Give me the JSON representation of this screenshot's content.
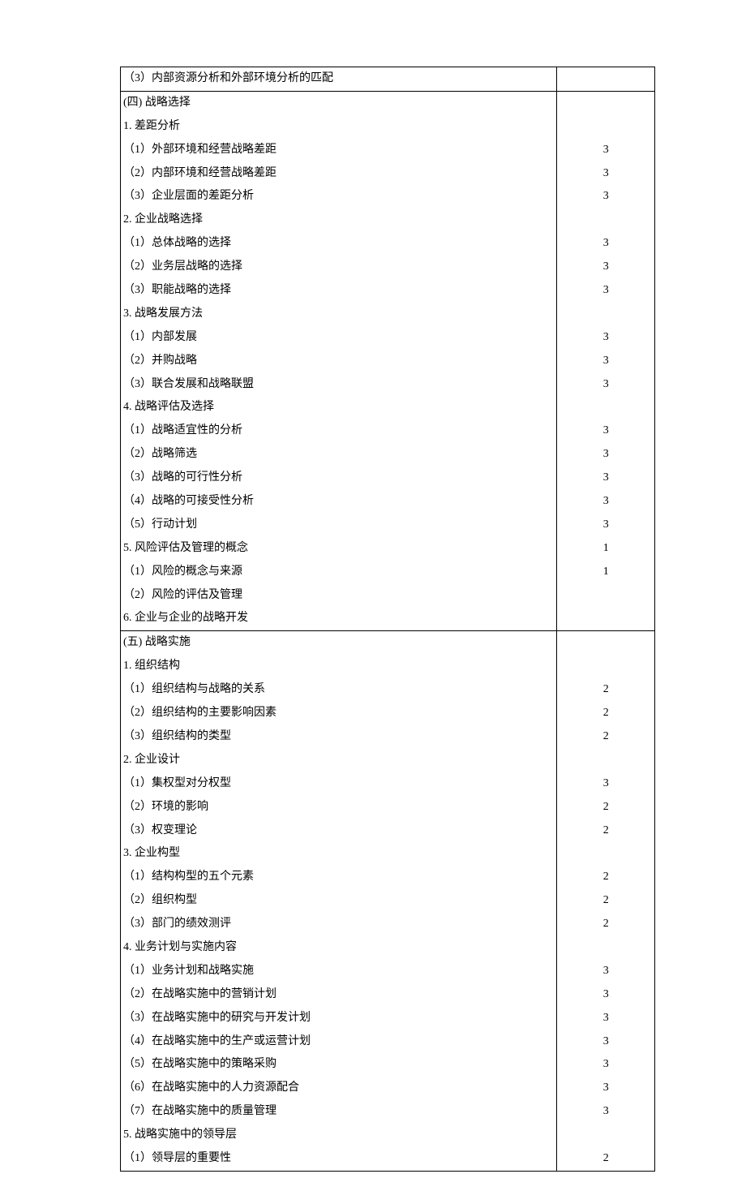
{
  "rows": [
    {
      "text": "（3）内部资源分析和外部环境分析的匹配",
      "indent": "p",
      "val": "",
      "sep": false
    },
    {
      "text": "(四)  战略选择",
      "indent": "h",
      "val": "",
      "sep": true
    },
    {
      "text": "1. 差距分析",
      "indent": "n",
      "val": "",
      "sep": false
    },
    {
      "text": "（1）外部环境和经营战略差距",
      "indent": "p",
      "val": "3",
      "sep": false
    },
    {
      "text": "（2）内部环境和经营战略差距",
      "indent": "p",
      "val": "3",
      "sep": false
    },
    {
      "text": "（3）企业层面的差距分析",
      "indent": "p2",
      "val": "3",
      "sep": false
    },
    {
      "text": "2. 企业战略选择",
      "indent": "n",
      "val": "",
      "sep": false
    },
    {
      "text": "（1）总体战略的选择",
      "indent": "p",
      "val": "3",
      "sep": false
    },
    {
      "text": "（2）业务层战略的选择",
      "indent": "p",
      "val": "3",
      "sep": false
    },
    {
      "text": "（3）职能战略的选择",
      "indent": "p",
      "val": "3",
      "sep": false
    },
    {
      "text": "3. 战略发展方法",
      "indent": "n",
      "val": "",
      "sep": false
    },
    {
      "text": "（1）内部发展",
      "indent": "p",
      "val": "3",
      "sep": false
    },
    {
      "text": "（2）并购战略",
      "indent": "p",
      "val": "3",
      "sep": false
    },
    {
      "text": "（3）联合发展和战略联盟",
      "indent": "p",
      "val": "3",
      "sep": false
    },
    {
      "text": "4. 战略评估及选择",
      "indent": "n",
      "val": "",
      "sep": false
    },
    {
      "text": "（1）战略适宜性的分析",
      "indent": "p",
      "val": "3",
      "sep": false
    },
    {
      "text": "（2）战略筛选",
      "indent": "p",
      "val": "3",
      "sep": false
    },
    {
      "text": "（3）战略的可行性分析",
      "indent": "p",
      "val": "3",
      "sep": false
    },
    {
      "text": "（4）战略的可接受性分析",
      "indent": "p",
      "val": "3",
      "sep": false
    },
    {
      "text": "（5）行动计划",
      "indent": "p",
      "val": "3",
      "sep": false
    },
    {
      "text": "5. 风险评估及管理的概念",
      "indent": "n",
      "val": "1",
      "sep": false
    },
    {
      "text": "（1）风险的概念与来源",
      "indent": "p",
      "val": "1",
      "sep": false
    },
    {
      "text": "（2）风险的评估及管理",
      "indent": "p",
      "val": "",
      "sep": false
    },
    {
      "text": "6. 企业与企业的战略开发",
      "indent": "n",
      "val": "",
      "sep": false
    },
    {
      "text": "(五)  战略实施",
      "indent": "h",
      "val": "",
      "sep": true
    },
    {
      "text": "1. 组织结构",
      "indent": "n",
      "val": "",
      "sep": false
    },
    {
      "text": "（1）组织结构与战略的关系",
      "indent": "p",
      "val": "2",
      "sep": false
    },
    {
      "text": "（2）组织结构的主要影响因素",
      "indent": "p",
      "val": "2",
      "sep": false
    },
    {
      "text": "（3）组织结构的类型",
      "indent": "p",
      "val": "2",
      "sep": false
    },
    {
      "text": "2. 企业设计",
      "indent": "n",
      "val": "",
      "sep": false
    },
    {
      "text": "（1）集权型对分权型",
      "indent": "p",
      "val": "3",
      "sep": false
    },
    {
      "text": "（2）环境的影响",
      "indent": "p",
      "val": "2",
      "sep": false
    },
    {
      "text": "（3）权变理论",
      "indent": "p",
      "val": "2",
      "sep": false
    },
    {
      "text": "3. 企业构型",
      "indent": "n",
      "val": "",
      "sep": false
    },
    {
      "text": "（1）结构构型的五个元素",
      "indent": "p",
      "val": "2",
      "sep": false
    },
    {
      "text": "（2）组织构型",
      "indent": "p",
      "val": "2",
      "sep": false
    },
    {
      "text": "（3）部门的绩效测评",
      "indent": "p",
      "val": "2",
      "sep": false
    },
    {
      "text": "4. 业务计划与实施内容",
      "indent": "n",
      "val": "",
      "sep": false
    },
    {
      "text": "（1）业务计划和战略实施",
      "indent": "p",
      "val": "3",
      "sep": false
    },
    {
      "text": "（2）在战略实施中的营销计划",
      "indent": "p",
      "val": "3",
      "sep": false
    },
    {
      "text": "（3）在战略实施中的研究与开发计划",
      "indent": "p",
      "val": "3",
      "sep": false
    },
    {
      "text": "（4）在战略实施中的生产或运营计划",
      "indent": "p",
      "val": "3",
      "sep": false
    },
    {
      "text": "（5）在战略实施中的策略采购",
      "indent": "p",
      "val": "3",
      "sep": false
    },
    {
      "text": "（6）在战略实施中的人力资源配合",
      "indent": "p",
      "val": "3",
      "sep": false
    },
    {
      "text": "（7）在战略实施中的质量管理",
      "indent": "p",
      "val": "3",
      "sep": false
    },
    {
      "text": "5. 战略实施中的领导层",
      "indent": "n",
      "val": "",
      "sep": false
    },
    {
      "text": "（1）领导层的重要性",
      "indent": "p",
      "val": "2",
      "sep": false
    }
  ]
}
